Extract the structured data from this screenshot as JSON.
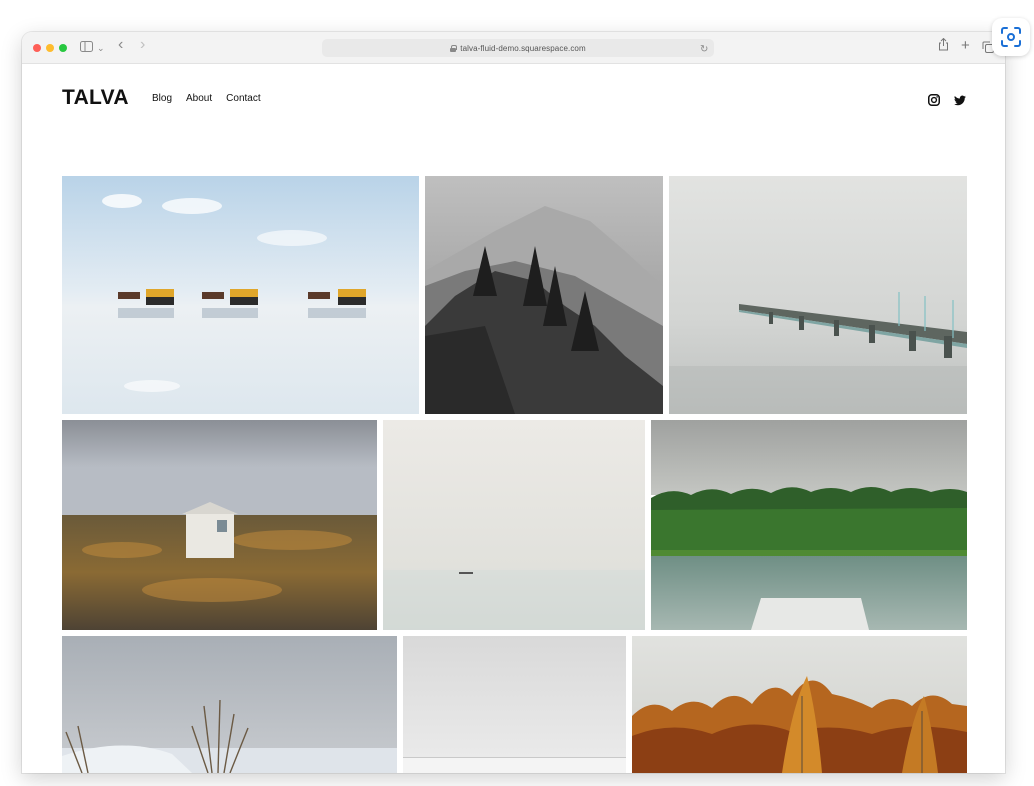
{
  "browser": {
    "url": "talva-fluid-demo.squarespace.com"
  },
  "site": {
    "logo": "TALVA",
    "nav": [
      {
        "label": "Blog"
      },
      {
        "label": "About"
      },
      {
        "label": "Contact"
      }
    ],
    "social": [
      "instagram-icon",
      "twitter-icon"
    ]
  },
  "gallery": {
    "photos": [
      "horse-carts-on-shore",
      "misty-mountain-forest",
      "pier-in-fog",
      "white-hut-on-tundra",
      "boat-on-calm-sea",
      "forest-lake-with-dock",
      "grass-on-icy-shore",
      "foggy-horizon",
      "autumn-trees"
    ]
  },
  "colors": {
    "accent_blue": "#1a6fd6",
    "text": "#111111"
  }
}
